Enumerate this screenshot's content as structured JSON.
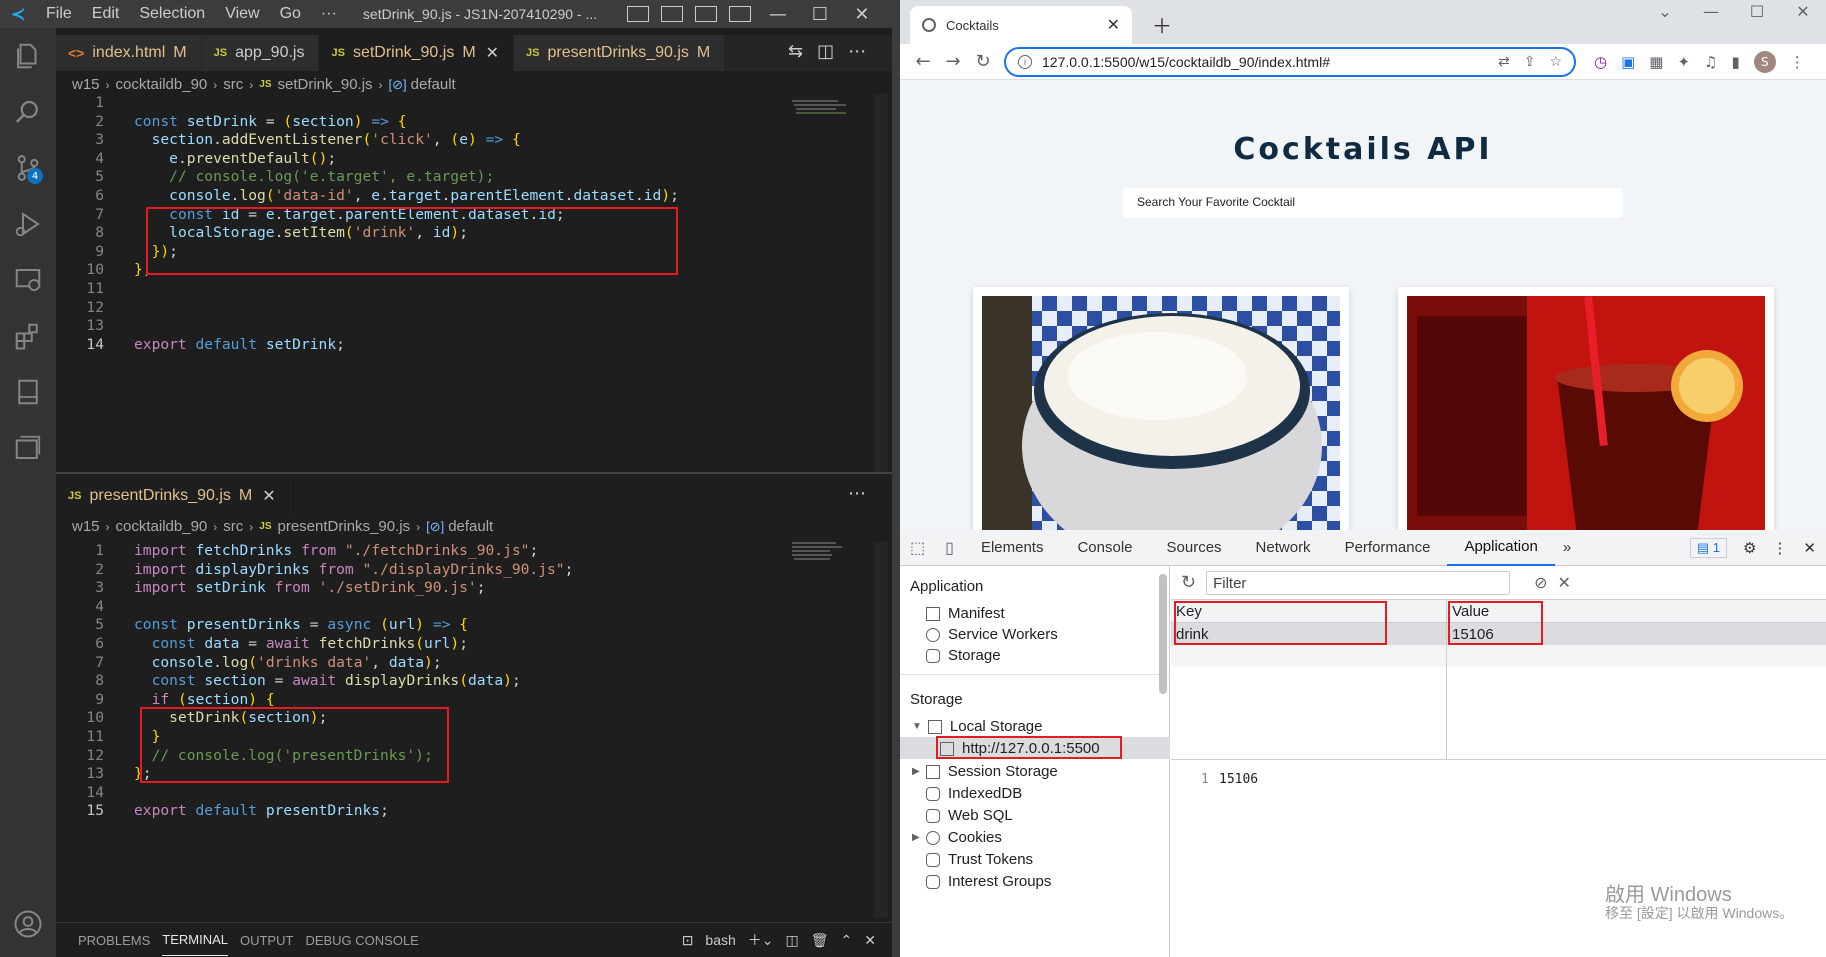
{
  "vscode": {
    "menu": [
      "File",
      "Edit",
      "Selection",
      "View",
      "Go",
      "···"
    ],
    "window_title": "setDrink_90.js - JS1N-207410290 - ...",
    "top_tabs": [
      {
        "icon": "<>",
        "name": "index.html",
        "mod": "M"
      },
      {
        "icon": "JS",
        "name": "app_90.js",
        "mod": ""
      },
      {
        "icon": "JS",
        "name": "setDrink_90.js",
        "mod": "M"
      },
      {
        "icon": "JS",
        "name": "presentDrinks_90.js",
        "mod": "M"
      }
    ],
    "scm_badge": "4",
    "top_breadcrumb": [
      "w15",
      "cocktaildb_90",
      "src",
      "setDrink_90.js",
      "default"
    ],
    "bottom_tab": {
      "icon": "JS",
      "name": "presentDrinks_90.js",
      "mod": "M"
    },
    "bottom_breadcrumb": [
      "w15",
      "cocktaildb_90",
      "src",
      "presentDrinks_90.js",
      "default"
    ],
    "top_code": [
      {
        "n": "1",
        "t": ""
      },
      {
        "n": "2",
        "t": "const setDrink = (section) => {"
      },
      {
        "n": "3",
        "t": "  section.addEventListener('click', (e) => {"
      },
      {
        "n": "4",
        "t": "    e.preventDefault();"
      },
      {
        "n": "5",
        "t": "    // console.log('e.target', e.target);"
      },
      {
        "n": "6",
        "t": "    console.log('data-id', e.target.parentElement.dataset.id);"
      },
      {
        "n": "7",
        "t": "    const id = e.target.parentElement.dataset.id;"
      },
      {
        "n": "8",
        "t": "    localStorage.setItem('drink', id);"
      },
      {
        "n": "9",
        "t": "  });"
      },
      {
        "n": "10",
        "t": "};"
      },
      {
        "n": "11",
        "t": ""
      },
      {
        "n": "12",
        "t": ""
      },
      {
        "n": "13",
        "t": ""
      },
      {
        "n": "14",
        "t": "export default setDrink;"
      }
    ],
    "bottom_code": [
      {
        "n": "1",
        "t": "import fetchDrinks from \"./fetchDrinks_90.js\";"
      },
      {
        "n": "2",
        "t": "import displayDrinks from \"./displayDrinks_90.js\";"
      },
      {
        "n": "3",
        "t": "import setDrink from './setDrink_90.js';"
      },
      {
        "n": "4",
        "t": ""
      },
      {
        "n": "5",
        "t": "const presentDrinks = async (url) => {"
      },
      {
        "n": "6",
        "t": "  const data = await fetchDrinks(url);"
      },
      {
        "n": "7",
        "t": "  console.log('drinks data', data);"
      },
      {
        "n": "8",
        "t": "  const section = await displayDrinks(data);"
      },
      {
        "n": "9",
        "t": "  if (section) {"
      },
      {
        "n": "10",
        "t": "    setDrink(section);"
      },
      {
        "n": "11",
        "t": "  }"
      },
      {
        "n": "12",
        "t": "  // console.log('presentDrinks');"
      },
      {
        "n": "13",
        "t": "};"
      },
      {
        "n": "14",
        "t": ""
      },
      {
        "n": "15",
        "t": "export default presentDrinks;"
      }
    ],
    "panel_tabs": [
      "PROBLEMS",
      "TERMINAL",
      "OUTPUT",
      "DEBUG CONSOLE"
    ],
    "terminal_shell": "bash"
  },
  "chrome": {
    "tab_title": "Cocktails",
    "url": "127.0.0.1:5500/w15/cocktaildb_90/index.html#",
    "profile_initial": "S",
    "page_title": "Cocktails API",
    "search_placeholder": "Search Your Favorite Cocktail"
  },
  "devtools": {
    "tabs": [
      "Elements",
      "Console",
      "Sources",
      "Network",
      "Performance",
      "Application"
    ],
    "issues_count": "1",
    "app_section": "Application",
    "app_items": [
      "Manifest",
      "Service Workers",
      "Storage"
    ],
    "storage_section": "Storage",
    "storage_items": [
      "Local Storage",
      "http://127.0.0.1:5500",
      "Session Storage",
      "IndexedDB",
      "Web SQL",
      "Cookies",
      "Trust Tokens",
      "Interest Groups"
    ],
    "filter_placeholder": "Filter",
    "col_key": "Key",
    "col_value": "Value",
    "row_key": "drink",
    "row_value": "15106",
    "preview_line": "1",
    "preview_value": "15106"
  },
  "watermark": {
    "line1": "啟用 Windows",
    "line2": "移至 [設定] 以啟用 Windows。"
  }
}
